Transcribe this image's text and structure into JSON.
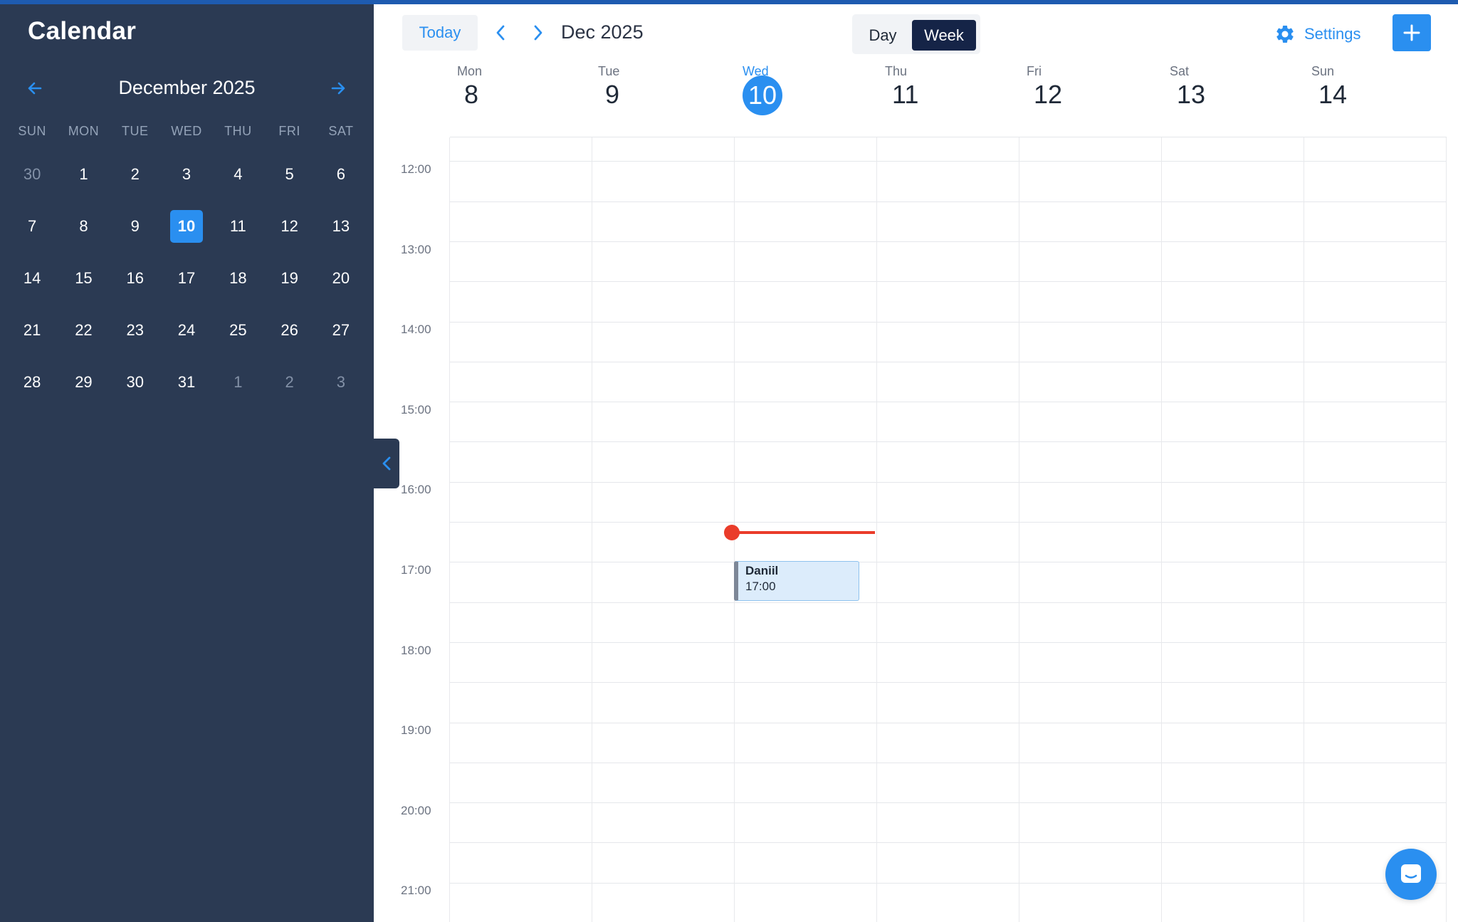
{
  "sidebar": {
    "title": "Calendar",
    "month_label": "December 2025",
    "dow": [
      "SUN",
      "MON",
      "TUE",
      "WED",
      "THU",
      "FRI",
      "SAT"
    ],
    "weeks": [
      [
        "30",
        "1",
        "2",
        "3",
        "4",
        "5",
        "6"
      ],
      [
        "7",
        "8",
        "9",
        "10",
        "11",
        "12",
        "13"
      ],
      [
        "14",
        "15",
        "16",
        "17",
        "18",
        "19",
        "20"
      ],
      [
        "21",
        "22",
        "23",
        "24",
        "25",
        "26",
        "27"
      ],
      [
        "28",
        "29",
        "30",
        "31",
        "1",
        "2",
        "3"
      ]
    ],
    "selected_day": "10"
  },
  "toolbar": {
    "today_label": "Today",
    "range_label": "Dec 2025",
    "views": {
      "day": "Day",
      "week": "Week",
      "active": "week"
    },
    "settings_label": "Settings"
  },
  "week": {
    "days": [
      {
        "name": "Mon",
        "num": "8"
      },
      {
        "name": "Tue",
        "num": "9"
      },
      {
        "name": "Wed",
        "num": "10",
        "current": true
      },
      {
        "name": "Thu",
        "num": "11"
      },
      {
        "name": "Fri",
        "num": "12"
      },
      {
        "name": "Sat",
        "num": "13"
      },
      {
        "name": "Sun",
        "num": "14"
      }
    ],
    "hours": [
      "12:00",
      "13:00",
      "14:00",
      "15:00",
      "16:00",
      "17:00",
      "18:00",
      "19:00",
      "20:00",
      "21:00"
    ]
  },
  "event": {
    "title": "Daniil",
    "time": "17:00"
  },
  "colors": {
    "sidebar_bg": "#2b3a53",
    "accent": "#2a8ff0",
    "now_line": "#ea3c2a",
    "active_view_bg": "#152447"
  },
  "icons": {
    "mini_prev": "arrow-left-icon",
    "mini_next": "arrow-right-icon",
    "nav_prev": "chevron-left-icon",
    "nav_next": "chevron-right-icon",
    "settings": "gear-icon",
    "add": "plus-icon",
    "collapse": "chevron-left-icon",
    "chat": "chat-icon"
  }
}
